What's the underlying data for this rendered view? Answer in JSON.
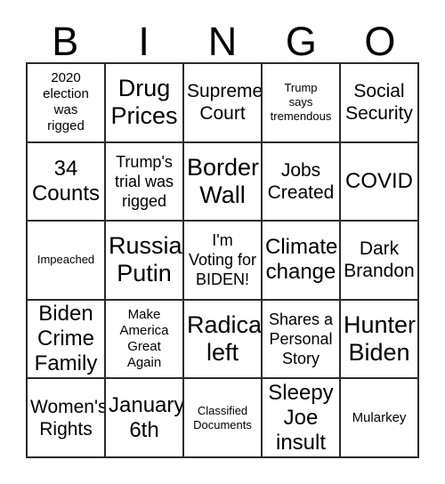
{
  "card": {
    "header_letters": [
      "B",
      "I",
      "N",
      "G",
      "O"
    ],
    "columns": 5,
    "rows": 5,
    "colors": {
      "background": "#ffffff",
      "border": "#2b2b2b",
      "text": "#000000"
    },
    "cells": [
      [
        {
          "text": "2020\nelection\nwas\nrigged",
          "size": "fs-sm"
        },
        {
          "text": "Drug\nPrices",
          "size": "fs-xxl"
        },
        {
          "text": "Supreme\nCourt",
          "size": "fs-lg"
        },
        {
          "text": "Trump\nsays\ntremendous",
          "size": "fs-xs"
        },
        {
          "text": "Social\nSecurity",
          "size": "fs-lg"
        }
      ],
      [
        {
          "text": "34\nCounts",
          "size": "fs-xl"
        },
        {
          "text": "Trump's\ntrial was\nrigged",
          "size": "fs-md"
        },
        {
          "text": "Border\nWall",
          "size": "fs-xxl"
        },
        {
          "text": "Jobs\nCreated",
          "size": "fs-lg"
        },
        {
          "text": "COVID",
          "size": "fs-xl"
        }
      ],
      [
        {
          "text": "Impeached",
          "size": "fs-xs"
        },
        {
          "text": "Russia/\nPutin",
          "size": "fs-xxl"
        },
        {
          "text": "I'm\nVoting for\nBIDEN!",
          "size": "fs-md"
        },
        {
          "text": "Climate\nchange",
          "size": "fs-xl"
        },
        {
          "text": "Dark\nBrandon",
          "size": "fs-lg"
        }
      ],
      [
        {
          "text": "Biden\nCrime\nFamily",
          "size": "fs-xl"
        },
        {
          "text": "Make\nAmerica\nGreat\nAgain",
          "size": "fs-sm"
        },
        {
          "text": "Radical\nleft",
          "size": "fs-xxl"
        },
        {
          "text": "Shares a\nPersonal\nStory",
          "size": "fs-md"
        },
        {
          "text": "Hunter\nBiden",
          "size": "fs-xxl"
        }
      ],
      [
        {
          "text": "Women's\nRights",
          "size": "fs-lg"
        },
        {
          "text": "January\n6th",
          "size": "fs-xl"
        },
        {
          "text": "Classified\nDocuments",
          "size": "fs-xs"
        },
        {
          "text": "Sleepy\nJoe\ninsult",
          "size": "fs-xl"
        },
        {
          "text": "Mularkey",
          "size": "fs-sm"
        }
      ]
    ]
  }
}
